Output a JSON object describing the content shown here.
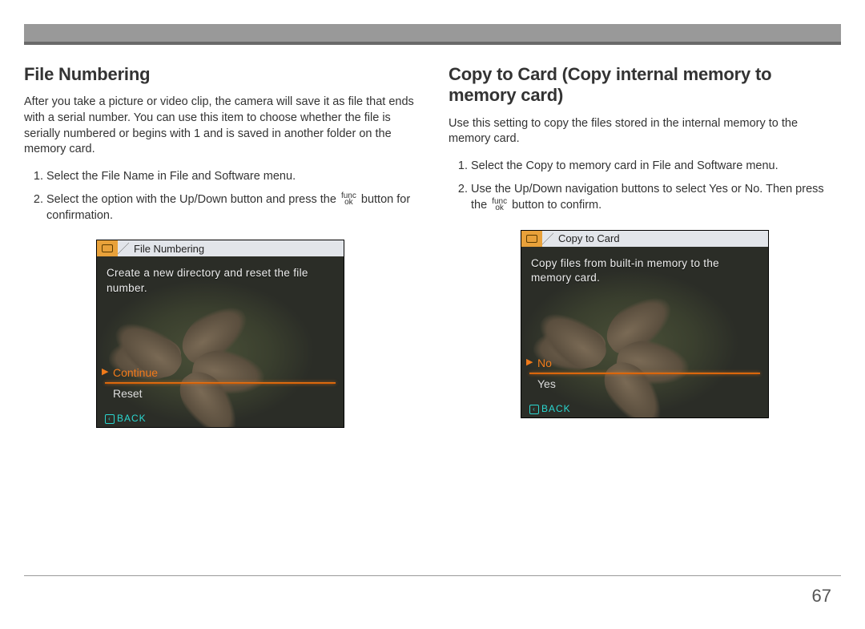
{
  "page_number": "67",
  "left": {
    "heading": "File Numbering",
    "lead": "After you take a picture or video clip, the camera will save it as file that ends with a serial number. You can use this item to choose whether the file is serially numbered or begins with 1 and is saved in another folder on the memory card.",
    "steps": [
      "Select the File Name in File and Software menu.",
      "Select the option with the Up/Down button and press the |func_ok| button for confirmation."
    ],
    "lcd": {
      "tab_label": "File Numbering",
      "desc": "Create a new directory and reset the file number.",
      "options": [
        {
          "label": "Continue",
          "selected": true
        },
        {
          "label": "Reset",
          "selected": false
        }
      ],
      "back": "BACK"
    }
  },
  "right": {
    "heading": "Copy to Card (Copy internal memory to memory card)",
    "lead": "Use this setting to copy the files stored in the internal memory to the memory card.",
    "steps": [
      "Select the Copy to memory card in File and Software menu.",
      "Use the Up/Down navigation buttons to select Yes or No. Then press the |func_ok| button to confirm."
    ],
    "lcd": {
      "tab_label": "Copy to Card",
      "desc": "Copy files from built-in memory to the memory card.",
      "options": [
        {
          "label": "No",
          "selected": true
        },
        {
          "label": "Yes",
          "selected": false
        }
      ],
      "back": "BACK"
    }
  },
  "func_ok": {
    "top": "func",
    "bottom": "ok"
  }
}
